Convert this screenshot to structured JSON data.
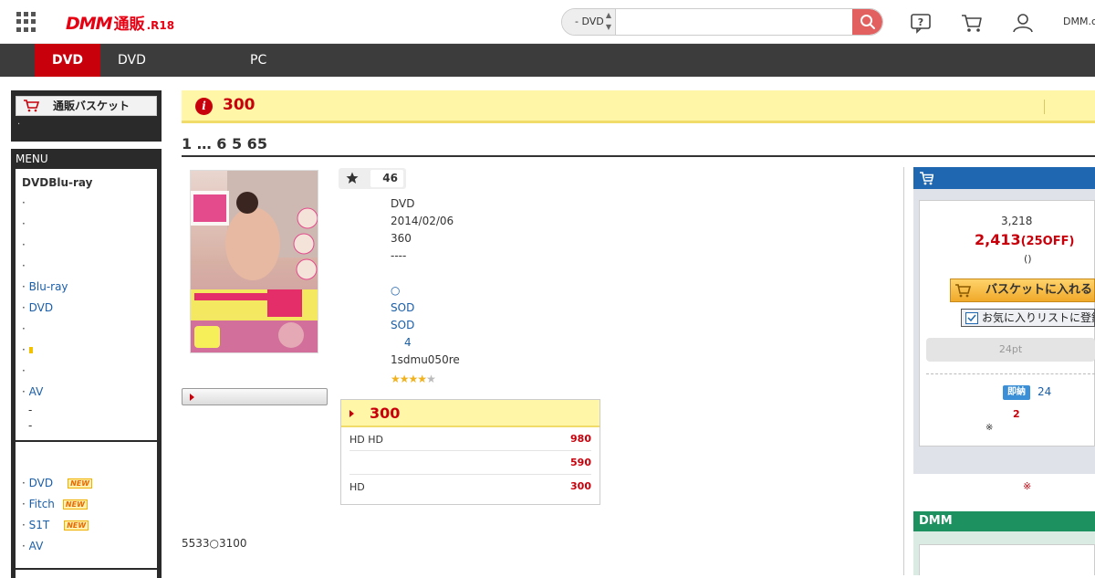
{
  "header": {
    "logo_brand": "DMM",
    "logo_service": "通販",
    "logo_suffix": ".R18",
    "search_category": "- DVD",
    "search_placeholder": "",
    "account_link": "DMM.co"
  },
  "nav": {
    "tabs": [
      {
        "label": "DVD",
        "active": true
      },
      {
        "label": "DVD",
        "active": false
      },
      {
        "label": "PC",
        "active": false
      }
    ]
  },
  "sidebar": {
    "basket_label": "通販バスケット",
    "basket_note": "·",
    "menu_head": "MENU",
    "menu_title": "DVDBlu-ray",
    "items": [
      {
        "text": "·"
      },
      {
        "text": "·"
      },
      {
        "text": "·"
      },
      {
        "text": "·"
      },
      {
        "text": "· ",
        "link": "Blu-ray"
      },
      {
        "text": "· ",
        "link": "DVD"
      },
      {
        "text": "·"
      },
      {
        "text": "·"
      },
      {
        "text": "·"
      },
      {
        "text": "· ",
        "link": "AV"
      },
      {
        "text": "-"
      },
      {
        "text": "-"
      }
    ],
    "items2": [
      {
        "text": "· ",
        "link": "DVD",
        "badge": "NEW"
      },
      {
        "text": "· ",
        "link": "Fitch",
        "badge": "NEW"
      },
      {
        "text": "· ",
        "link": "S1T",
        "badge": "NEW"
      },
      {
        "text": "· ",
        "link": "AV"
      }
    ]
  },
  "notice": {
    "icon": "i",
    "text": "300"
  },
  "pager": {
    "text": "1 … 6 5 65"
  },
  "product": {
    "rating_count": "46",
    "format": "DVD",
    "release_date": "2014/02/06",
    "duration": "360",
    "dashes": "----",
    "circle": "○",
    "maker": "SOD",
    "label": "SOD",
    "series_count": "4",
    "product_code": "1sdmu050re",
    "stars": 4,
    "review_summary": "5533○3100"
  },
  "price_box": {
    "head": "300",
    "rows": [
      {
        "label": "HD  HD",
        "value": "980"
      },
      {
        "label": "",
        "value": "590"
      },
      {
        "label": "HD",
        "value": "300"
      }
    ]
  },
  "buy": {
    "original_price": "3,218",
    "sale_price": "2,413",
    "discount": "(25OFF)",
    "paren": "()",
    "cart_label": "バスケットに入れる",
    "fav_label": "お気に入りリストに登録",
    "points": "24pt",
    "sokuno": "即納",
    "stock": "24",
    "red_two": "2",
    "note": "※",
    "red_note": "※"
  },
  "dmm_box": {
    "title": "DMM"
  },
  "colors": {
    "brand_red": "#e60012",
    "nav_dark": "#3c3c3c",
    "active_tab": "#c8000b",
    "buy_blue": "#1f67b1",
    "dmm_green": "#1e9160"
  }
}
